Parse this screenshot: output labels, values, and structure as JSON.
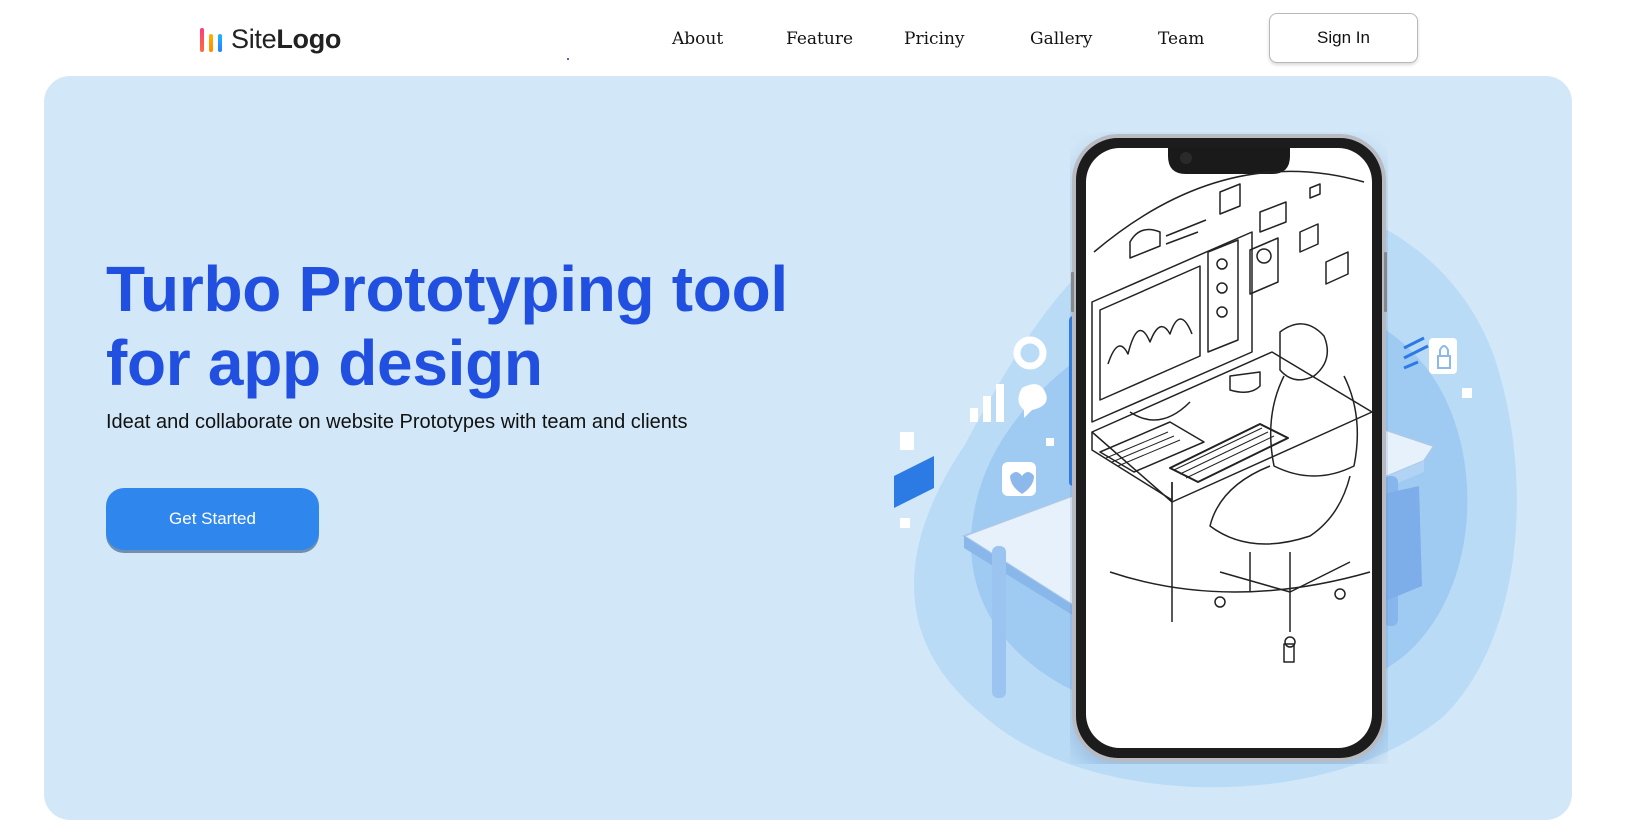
{
  "header": {
    "logo": {
      "text_light": "Site",
      "text_bold": "Logo",
      "icon": "bars-logo-icon"
    },
    "nav": [
      {
        "label": "About"
      },
      {
        "label": "Feature"
      },
      {
        "label": "Priciny"
      },
      {
        "label": "Gallery"
      },
      {
        "label": "Team"
      }
    ],
    "signin_label": "Sign In"
  },
  "hero": {
    "title_line1": "Turbo Prototyping tool",
    "title_line2": "for app design",
    "subtitle": "Ideat and collaborate on website Prototypes with team and clients",
    "cta_label": "Get Started",
    "illustration": "phone-desk-illustration"
  },
  "colors": {
    "hero_bg": "#d2e8f8",
    "title": "#2150e0",
    "cta": "#2f87ee",
    "blob_outer": "#b9dbf6",
    "blob_inner": "#8fc2f2"
  }
}
